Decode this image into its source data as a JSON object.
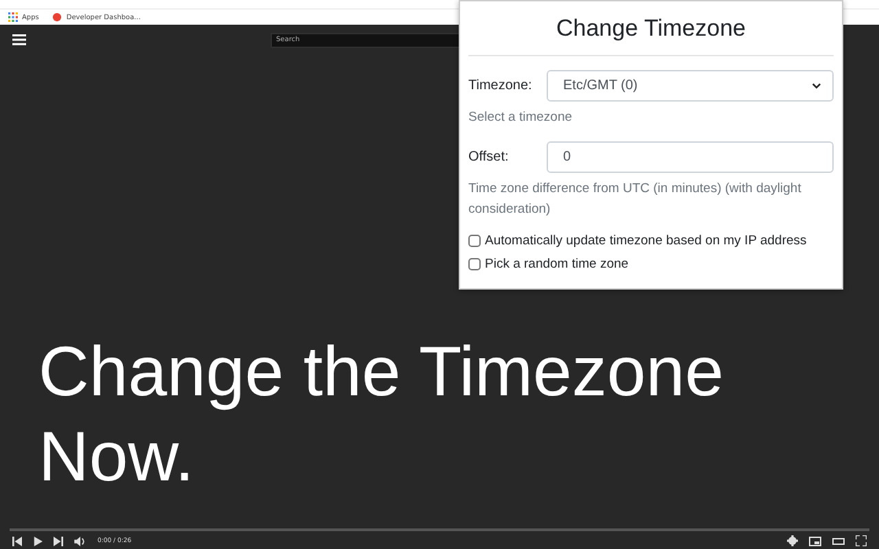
{
  "bookmarks_bar": {
    "items": [
      {
        "label": "Apps",
        "kind": "apps"
      },
      {
        "label": "Developer Dashboa...",
        "kind": "page"
      }
    ]
  },
  "video_page": {
    "search": {
      "placeholder": "Search"
    },
    "headline": [
      "Change the Timezone",
      "Now."
    ],
    "player": {
      "time": "0:00 / 0:26"
    }
  },
  "popup": {
    "title": "Change Timezone",
    "timezone": {
      "label": "Timezone:",
      "value": "Etc/GMT (0)",
      "help": "Select a timezone"
    },
    "offset": {
      "label": "Offset:",
      "value": "0",
      "help": "Time zone difference from UTC (in minutes) (with daylight consideration)"
    },
    "options": [
      {
        "label": "Automatically update timezone based on my IP address",
        "checked": false
      },
      {
        "label": "Pick a random time zone",
        "checked": false
      }
    ]
  }
}
